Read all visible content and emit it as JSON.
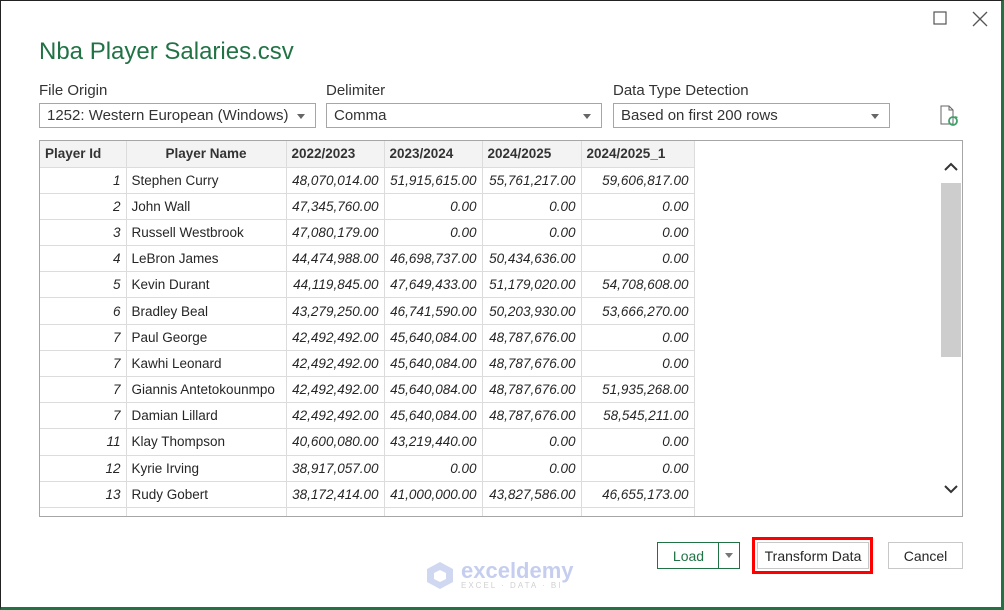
{
  "dialog": {
    "title": "Nba Player Salaries.csv"
  },
  "options": {
    "file_origin": {
      "label": "File Origin",
      "value": "1252: Western European (Windows)"
    },
    "delimiter": {
      "label": "Delimiter",
      "value": "Comma"
    },
    "detection": {
      "label": "Data Type Detection",
      "value": "Based on first 200 rows"
    }
  },
  "table": {
    "columns": [
      "Player Id",
      "Player Name",
      "2022/2023",
      "2023/2024",
      "2024/2025",
      "2024/2025_1"
    ],
    "rows": [
      [
        "1",
        "Stephen Curry",
        "48,070,014.00",
        "51,915,615.00",
        "55,761,217.00",
        "59,606,817.00"
      ],
      [
        "2",
        "John Wall",
        "47,345,760.00",
        "0.00",
        "0.00",
        "0.00"
      ],
      [
        "3",
        "Russell Westbrook",
        "47,080,179.00",
        "0.00",
        "0.00",
        "0.00"
      ],
      [
        "4",
        "LeBron James",
        "44,474,988.00",
        "46,698,737.00",
        "50,434,636.00",
        "0.00"
      ],
      [
        "5",
        "Kevin Durant",
        "44,119,845.00",
        "47,649,433.00",
        "51,179,020.00",
        "54,708,608.00"
      ],
      [
        "6",
        "Bradley Beal",
        "43,279,250.00",
        "46,741,590.00",
        "50,203,930.00",
        "53,666,270.00"
      ],
      [
        "7",
        "Paul George",
        "42,492,492.00",
        "45,640,084.00",
        "48,787,676.00",
        "0.00"
      ],
      [
        "7",
        "Kawhi Leonard",
        "42,492,492.00",
        "45,640,084.00",
        "48,787,676.00",
        "0.00"
      ],
      [
        "7",
        "Giannis Antetokounmpo",
        "42,492,492.00",
        "45,640,084.00",
        "48,787,676.00",
        "51,935,268.00"
      ],
      [
        "7",
        "Damian Lillard",
        "42,492,492.00",
        "45,640,084.00",
        "48,787,676.00",
        "58,545,211.00"
      ],
      [
        "11",
        "Klay Thompson",
        "40,600,080.00",
        "43,219,440.00",
        "0.00",
        "0.00"
      ],
      [
        "12",
        "Kyrie Irving",
        "38,917,057.00",
        "0.00",
        "0.00",
        "0.00"
      ],
      [
        "13",
        "Rudy Gobert",
        "38,172,414.00",
        "41,000,000.00",
        "43,827,586.00",
        "46,655,173.00"
      ],
      [
        "",
        "",
        "",
        "",
        "",
        ""
      ]
    ]
  },
  "buttons": {
    "load": "Load",
    "transform": "Transform Data",
    "cancel": "Cancel"
  },
  "watermark": {
    "name": "exceldemy",
    "tagline": "EXCEL · DATA · BI"
  },
  "colors": {
    "accent": "#217346",
    "highlight": "#ff0000"
  }
}
